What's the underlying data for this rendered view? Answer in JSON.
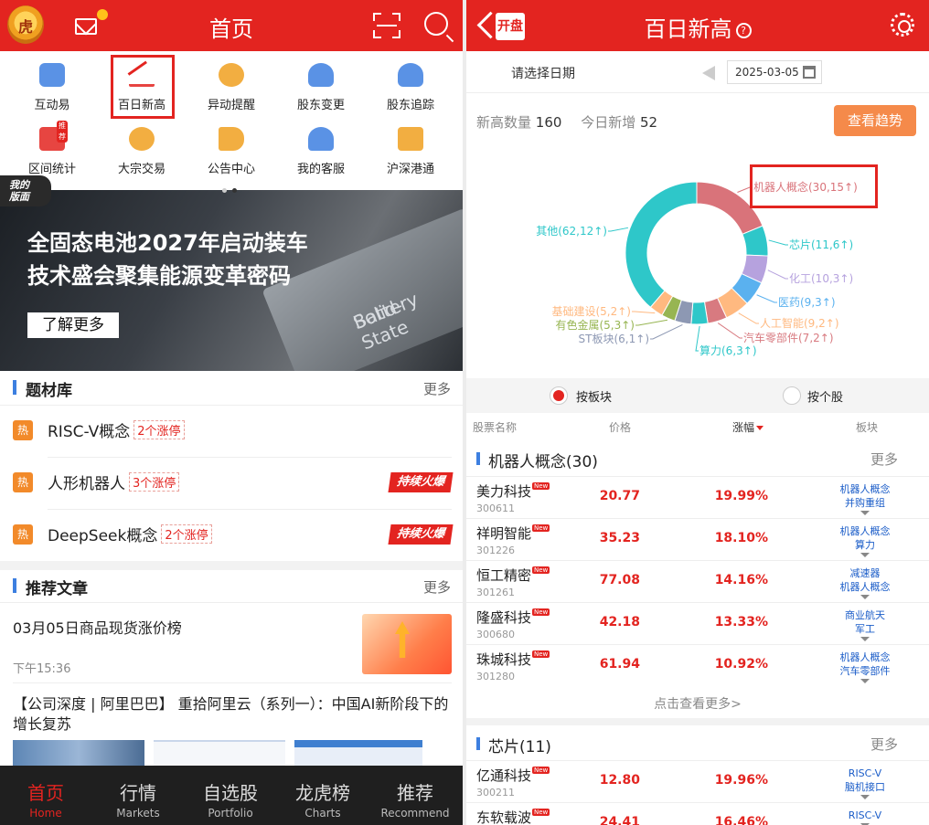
{
  "left": {
    "header": {
      "title": "首页"
    },
    "menu": [
      {
        "label": "互动易",
        "icon": "chat-icon",
        "color": "#3d7fe0"
      },
      {
        "label": "百日新高",
        "icon": "new-high-chart-icon",
        "color": "#e32420"
      },
      {
        "label": "异动提醒",
        "icon": "alert-icon",
        "color": "#f0a020"
      },
      {
        "label": "股东变更",
        "icon": "shareholder-change-icon",
        "color": "#3d7fe0"
      },
      {
        "label": "股东追踪",
        "icon": "shareholder-track-icon",
        "color": "#3d7fe0"
      },
      {
        "label": "区间统计",
        "icon": "range-stats-icon",
        "color": "#e32420",
        "badge": "推荐"
      },
      {
        "label": "大宗交易",
        "icon": "block-trade-icon",
        "color": "#f0a020"
      },
      {
        "label": "公告中心",
        "icon": "announcement-icon",
        "color": "#f0a020"
      },
      {
        "label": "我的客服",
        "icon": "headset-icon",
        "color": "#3d7fe0"
      },
      {
        "label": "沪深港通",
        "icon": "hk-connect-icon",
        "color": "#f0a020"
      }
    ],
    "mine_tab": "我的版面",
    "banner": {
      "line1": "全固态电池2027年启动装车",
      "line2": "技术盛会聚集能源变革密码",
      "button": "了解更多",
      "battery_text1": "Solid-State",
      "battery_text2": "Battery"
    },
    "topics": {
      "title": "题材库",
      "more": "更多",
      "items": [
        {
          "hot": "热",
          "name": "RISC-V概念",
          "tag": "2个涨停",
          "fire": ""
        },
        {
          "hot": "热",
          "name": "人形机器人",
          "tag": "3个涨停",
          "fire": "持续火爆"
        },
        {
          "hot": "热",
          "name": "DeepSeek概念",
          "tag": "2个涨停",
          "fire": "持续火爆"
        }
      ]
    },
    "articles": {
      "title": "推荐文章",
      "more": "更多",
      "a1_title": "03月05日商品现货涨价榜",
      "a1_time": "下午15:36",
      "a2_title": "【公司深度 | 阿里巴巴】 重拾阿里云（系列一）：中国AI新阶段下的增长复苏"
    },
    "tabs": [
      {
        "cn": "首页",
        "en": "Home"
      },
      {
        "cn": "行情",
        "en": "Markets"
      },
      {
        "cn": "自选股",
        "en": "Portfolio"
      },
      {
        "cn": "龙虎榜",
        "en": "Charts"
      },
      {
        "cn": "推荐",
        "en": "Recommend"
      }
    ]
  },
  "right": {
    "header": {
      "title": "百日新高",
      "back_badge": "开盘",
      "help": "?"
    },
    "date_label": "请选择日期",
    "date_value": "2025-03-05",
    "stats": {
      "count_label": "新高数量",
      "count": "160",
      "new_label": "今日新增",
      "new": "52"
    },
    "trend_button": "查看趋势",
    "chart_data": {
      "type": "pie",
      "style": "donut",
      "slices": [
        {
          "name": "机器人概念",
          "label": "机器人概念(30,15↑)",
          "value": 30,
          "color": "#d9737a"
        },
        {
          "name": "芯片",
          "label": "芯片(11,6↑)",
          "value": 11,
          "color": "#2ec7c9"
        },
        {
          "name": "化工",
          "label": "化工(10,3↑)",
          "value": 10,
          "color": "#b6a2de"
        },
        {
          "name": "医药",
          "label": "医药(9,3↑)",
          "value": 9,
          "color": "#5ab1ef"
        },
        {
          "name": "人工智能",
          "label": "人工智能(9,2↑)",
          "value": 9,
          "color": "#ffb980"
        },
        {
          "name": "汽车零部件",
          "label": "汽车零部件(7,2↑)",
          "value": 7,
          "color": "#d87a80"
        },
        {
          "name": "算力",
          "label": "算力(6,3↑)",
          "value": 6,
          "color": "#2ec7c9"
        },
        {
          "name": "ST板块",
          "label": "ST板块(6,1↑)",
          "value": 6,
          "color": "#8d98b3"
        },
        {
          "name": "有色金属",
          "label": "有色金属(5,3↑)",
          "value": 5,
          "color": "#97b552"
        },
        {
          "name": "基础建设",
          "label": "基础建设(5,2↑)",
          "value": 5,
          "color": "#ffb980"
        },
        {
          "name": "其他",
          "label": "其他(62,12↑)",
          "value": 62,
          "color": "#2ec7c9"
        }
      ]
    },
    "radio": {
      "by_sector": "按板块",
      "by_stock": "按个股"
    },
    "columns": {
      "name": "股票名称",
      "price": "价格",
      "change": "涨幅",
      "sector": "板块"
    },
    "group1": {
      "title": "机器人概念(30)",
      "more": "更多",
      "rows": [
        {
          "name": "美力科技",
          "code": "300611",
          "price": "20.77",
          "change": "19.99%",
          "s1": "机器人概念",
          "s2": "并购重组"
        },
        {
          "name": "祥明智能",
          "code": "301226",
          "price": "35.23",
          "change": "18.10%",
          "s1": "机器人概念",
          "s2": "算力"
        },
        {
          "name": "恒工精密",
          "code": "301261",
          "price": "77.08",
          "change": "14.16%",
          "s1": "减速器",
          "s2": "机器人概念"
        },
        {
          "name": "隆盛科技",
          "code": "300680",
          "price": "42.18",
          "change": "13.33%",
          "s1": "商业航天",
          "s2": "军工"
        },
        {
          "name": "珠城科技",
          "code": "301280",
          "price": "61.94",
          "change": "10.92%",
          "s1": "机器人概念",
          "s2": "汽车零部件"
        }
      ],
      "see_more": "点击查看更多>"
    },
    "group2": {
      "title": "芯片(11)",
      "more": "更多",
      "rows": [
        {
          "name": "亿通科技",
          "code": "300211",
          "price": "12.80",
          "change": "19.96%",
          "s1": "RISC-V",
          "s2": "脑机接口"
        },
        {
          "name": "东软载波",
          "code": "",
          "price": "24.41",
          "change": "16.46%",
          "s1": "RISC-V",
          "s2": ""
        }
      ]
    },
    "new_badge": "New"
  }
}
